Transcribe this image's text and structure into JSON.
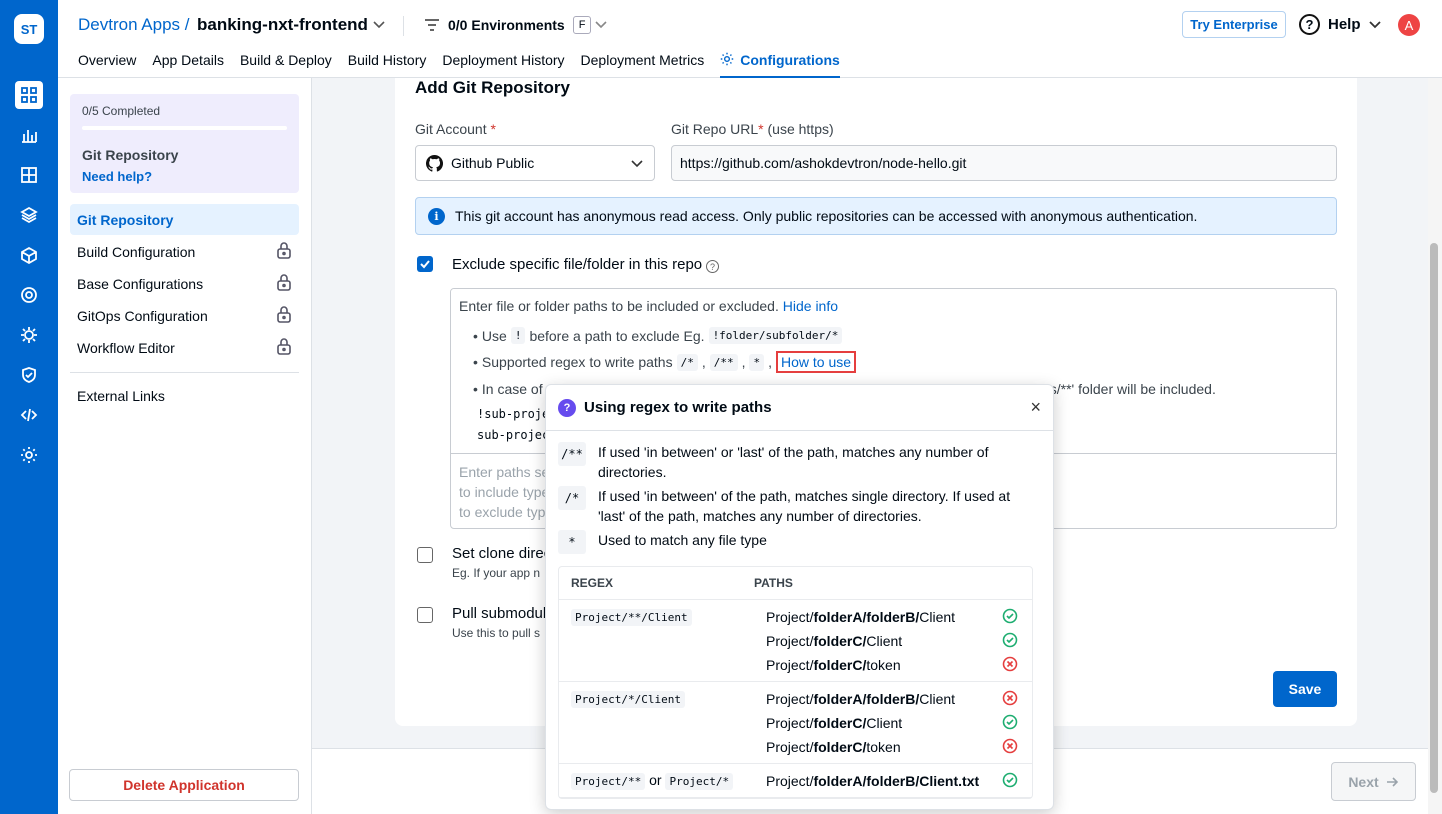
{
  "logo": {
    "text": "ST"
  },
  "header": {
    "breadcrumb": "Devtron Apps /",
    "app_name": "banking-nxt-frontend",
    "env_label": "0/0 Environments",
    "env_badge": "F",
    "try_enterprise": "Try Enterprise",
    "help": "Help",
    "avatar": "A"
  },
  "tabs": [
    "Overview",
    "App Details",
    "Build & Deploy",
    "Build History",
    "Deployment History",
    "Deployment Metrics",
    "Configurations"
  ],
  "sidebar": {
    "progress": "0/5 Completed",
    "progress_fraction": 0.0,
    "current_step": "Git Repository",
    "need_help": "Need help?",
    "steps": [
      {
        "label": "Git Repository"
      },
      {
        "label": "Build Configuration"
      },
      {
        "label": "Base Configurations"
      },
      {
        "label": "GitOps Configuration"
      },
      {
        "label": "Workflow Editor"
      }
    ],
    "external_links": "External Links",
    "delete": "Delete Application"
  },
  "form": {
    "title": "Add Git Repository",
    "git_account_label": "Git Account",
    "required": "*",
    "git_account_value": "Github Public",
    "repo_url_label": "Git Repo URL",
    "repo_url_suffix": "(use https)",
    "repo_url_value": "https://github.com/ashokdevtron/node-hello.git",
    "info": "This git account has anonymous read access. Only public repositories can be accessed with anonymous authentication.",
    "exclude_label": "Exclude specific file/folder in this repo",
    "exclude_hint": "Enter file or folder paths to be included or excluded.",
    "hide_info": "Hide info",
    "b1_pre": "Use",
    "b1_code": "!",
    "b1_mid": "before a path to exclude Eg.",
    "b1_code2": "!folder/subfolder/*",
    "b2_pre": "Supported regex to write paths",
    "b2_c1": "/*",
    "b2_c2": "/**",
    "b2_c3": "*",
    "comma": ",",
    "how_to_use": "How to use",
    "b3_pre": "In case of",
    "b3_tail": "'/docs/**' folder will be included.",
    "code_l1": "!sub-proje",
    "code_l2": "sub-projec",
    "ta_l1": "Enter paths se",
    "ta_l2": "to include type",
    "ta_l3": "to exclude typ",
    "clone_label": "Set clone direc",
    "clone_sub": "Eg. If your app n",
    "submod_label": "Pull submodul",
    "submod_sub": "Use this to pull s",
    "save": "Save"
  },
  "bottom": {
    "next": "Next"
  },
  "popup": {
    "title": "Using regex to write paths",
    "close": "×",
    "rules": [
      {
        "sym": "/**",
        "desc": "If used 'in between' or 'last' of the path, matches any number of directories."
      },
      {
        "sym": "/*",
        "desc": "If used 'in between' of the path, matches single directory. If used at 'last' of the path, matches any number of directories."
      },
      {
        "sym": "*",
        "desc": "Used to match any file type"
      }
    ],
    "table_headers": [
      "REGEX",
      "PATHS"
    ],
    "or": "or",
    "rows": [
      {
        "regex": "Project/**/Client",
        "paths": [
          {
            "pre": "Project/",
            "bold": "folderA/folderB/",
            "post": "Client",
            "ok": true
          },
          {
            "pre": "Project/",
            "bold": "folderC/",
            "post": "Client",
            "ok": true
          },
          {
            "pre": "Project/",
            "bold": "folderC/",
            "post": "token",
            "ok": false
          }
        ]
      },
      {
        "regex": "Project/*/Client",
        "paths": [
          {
            "pre": "Project/",
            "bold": "folderA/folderB/",
            "post": "Client",
            "ok": false
          },
          {
            "pre": "Project/",
            "bold": "folderC/",
            "post": "Client",
            "ok": true
          },
          {
            "pre": "Project/",
            "bold": "folderC/",
            "post": "token",
            "ok": false
          }
        ]
      },
      {
        "regex": "Project/**",
        "regex2": "Project/*",
        "paths": [
          {
            "pre": "Project/",
            "bold": "folderA/folderB/Client.txt",
            "post": "",
            "ok": true
          }
        ]
      }
    ]
  },
  "colors": {
    "primary": "#0066cc",
    "danger": "#d0342c",
    "success": "#1dad70"
  }
}
